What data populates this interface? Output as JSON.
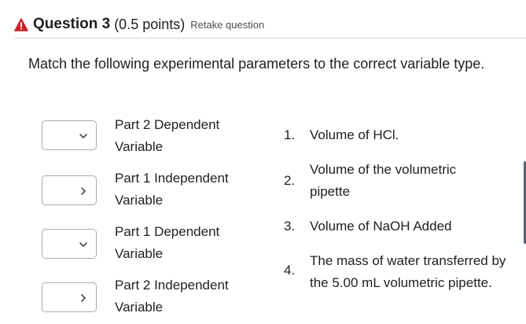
{
  "question": {
    "title": "Question 3",
    "points": "(0.5 points)",
    "retake_label": "Retake question",
    "prompt": "Match the following experimental parameters to the correct variable type."
  },
  "items": [
    {
      "label_line1": "Part 2 Dependent",
      "label_line2": "Variable",
      "selected": ""
    },
    {
      "label_line1": "Part 1 Independent",
      "label_line2": "Variable",
      "selected": ""
    },
    {
      "label_line1": "Part 1 Dependent",
      "label_line2": "Variable",
      "selected": ""
    },
    {
      "label_line1": "Part 2 Independent",
      "label_line2": "Variable",
      "selected": ""
    }
  ],
  "choices": [
    {
      "num": "1.",
      "text": "Volume of HCl."
    },
    {
      "num": "2.",
      "text": "Volume of the volumetric pipette"
    },
    {
      "num": "3.",
      "text": "Volume of NaOH Added"
    },
    {
      "num": "4.",
      "text": "The mass of water transferred by the 5.00 mL volumetric pipette."
    }
  ],
  "colors": {
    "warning": "#cd2026",
    "border": "#a6adb6",
    "text": "#202122"
  },
  "icons": {
    "warning": "warning-triangle-icon",
    "select": "chevron-down-icon"
  }
}
